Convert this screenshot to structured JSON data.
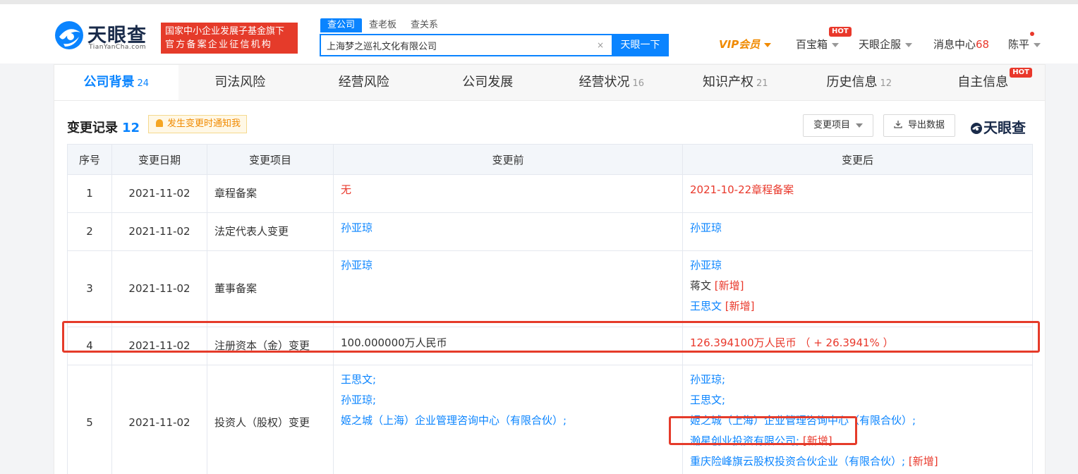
{
  "header": {
    "logo_cn": "天眼查",
    "logo_en": "TianYanCha.com",
    "badge_line1": "国家中小企业发展子基金旗下",
    "badge_line2": "官方备案企业征信机构",
    "search_tabs": [
      "查公司",
      "查老板",
      "查关系"
    ],
    "search_value": "上海梦之巡礼文化有限公司",
    "search_button": "天眼一下",
    "nav": {
      "vip": "VIP会员",
      "treasure": "百宝箱",
      "hot": "HOT",
      "enterprise": "天眼企服",
      "messages": "消息中心",
      "message_count": "68",
      "user": "陈平"
    }
  },
  "tabs": [
    {
      "label": "公司背景",
      "count": "24"
    },
    {
      "label": "司法风险",
      "count": ""
    },
    {
      "label": "经营风险",
      "count": ""
    },
    {
      "label": "公司发展",
      "count": ""
    },
    {
      "label": "经营状况",
      "count": "16"
    },
    {
      "label": "知识产权",
      "count": "21"
    },
    {
      "label": "历史信息",
      "count": "12"
    },
    {
      "label": "自主信息",
      "count": ""
    }
  ],
  "tab_hot": "HOT",
  "section": {
    "title": "变更记录",
    "count": "12",
    "notify": "发生变更时通知我",
    "filter_button": "变更项目",
    "export_button": "导出数据",
    "brand": "天眼查"
  },
  "table": {
    "headers": [
      "序号",
      "变更日期",
      "变更项目",
      "变更前",
      "变更后"
    ],
    "rows": [
      {
        "index": "1",
        "date": "2021-11-02",
        "item": "章程备案",
        "before": "无",
        "after": "2021-10-22章程备案"
      },
      {
        "index": "2",
        "date": "2021-11-02",
        "item": "法定代表人变更",
        "before": "孙亚琼",
        "after": "孙亚琼"
      },
      {
        "index": "3",
        "date": "2021-11-02",
        "item": "董事备案",
        "before": "孙亚琼",
        "after_lines": [
          {
            "name": "孙亚琼",
            "tag": ""
          },
          {
            "name": "蒋文",
            "tag": "[新增]"
          },
          {
            "name": "王思文",
            "tag": "[新增]"
          }
        ]
      },
      {
        "index": "4",
        "date": "2021-11-02",
        "item": "注册资本（金）变更",
        "before": "100.000000万人民币",
        "after": "126.394100万人民币 （ + 26.3941% ）"
      },
      {
        "index": "5",
        "date": "2021-11-02",
        "item": "投资人（股权）变更",
        "before_lines": [
          "王思文;",
          "孙亚琼;",
          "姬之城（上海）企业管理咨询中心（有限合伙）;"
        ],
        "after_lines": [
          {
            "name": "孙亚琼;",
            "tag": ""
          },
          {
            "name": "王思文;",
            "tag": ""
          },
          {
            "name": "姬之城（上海）企业管理咨询中心（有限合伙）;",
            "tag": ""
          },
          {
            "name": "瀚星创业投资有限公司;",
            "tag": "[新增]"
          },
          {
            "name": "重庆险峰旗云股权投资合伙企业（有限合伙）;",
            "tag": "[新增]"
          }
        ]
      }
    ]
  },
  "colors": {
    "brand_blue": "#0a84ff",
    "alert_red": "#e9382b",
    "vip_orange": "#f08a00"
  }
}
